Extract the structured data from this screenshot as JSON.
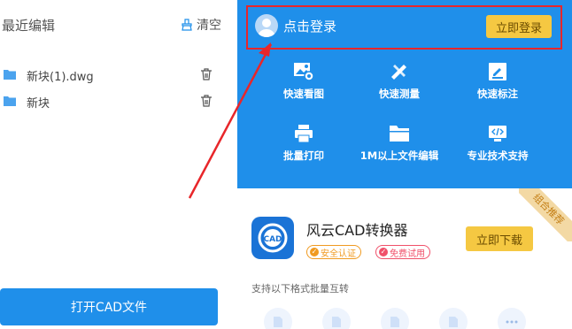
{
  "left": {
    "title": "最近编辑",
    "clear_label": "清空",
    "files": [
      {
        "name": "新块(1).dwg"
      },
      {
        "name": "新块"
      }
    ],
    "open_button": "打开CAD文件"
  },
  "login": {
    "text": "点击登录",
    "button": "立即登录"
  },
  "tools": [
    {
      "label": "快速看图",
      "icon": "image-view-icon"
    },
    {
      "label": "快速测量",
      "icon": "ruler-pencil-icon"
    },
    {
      "label": "快速标注",
      "icon": "annotate-icon"
    },
    {
      "label": "批量打印",
      "icon": "printer-icon"
    },
    {
      "label": "1M以上文件编辑",
      "icon": "folder-icon"
    },
    {
      "label": "专业技术支持",
      "icon": "code-icon"
    }
  ],
  "product": {
    "ribbon": "组合推荐",
    "name": "风云CAD转换器",
    "logo_text": "CAD",
    "tags": [
      "安全认证",
      "免费试用"
    ],
    "download_button": "立即下载",
    "formats_title": "支持以下格式批量互转"
  },
  "colors": {
    "primary": "#1f8fea",
    "accent": "#f5c842",
    "highlight": "#e8262a"
  }
}
